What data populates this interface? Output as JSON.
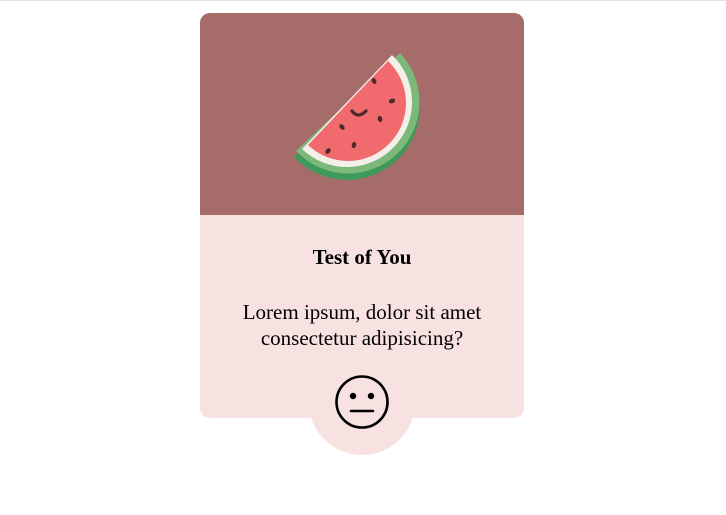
{
  "card": {
    "image_icon": "watermelon-icon",
    "title": "Test of You",
    "text": "Lorem ipsum, dolor sit amet consectetur adipisicing?",
    "reaction_icon": "neutral-face-icon",
    "colors": {
      "media_background": "#a56c69",
      "card_background": "#f7e2e1",
      "rind_dark": "#3e9a5b",
      "rind_light": "#7cb87a",
      "flesh": "#f06a6e",
      "seed": "#4a2a2a"
    }
  }
}
